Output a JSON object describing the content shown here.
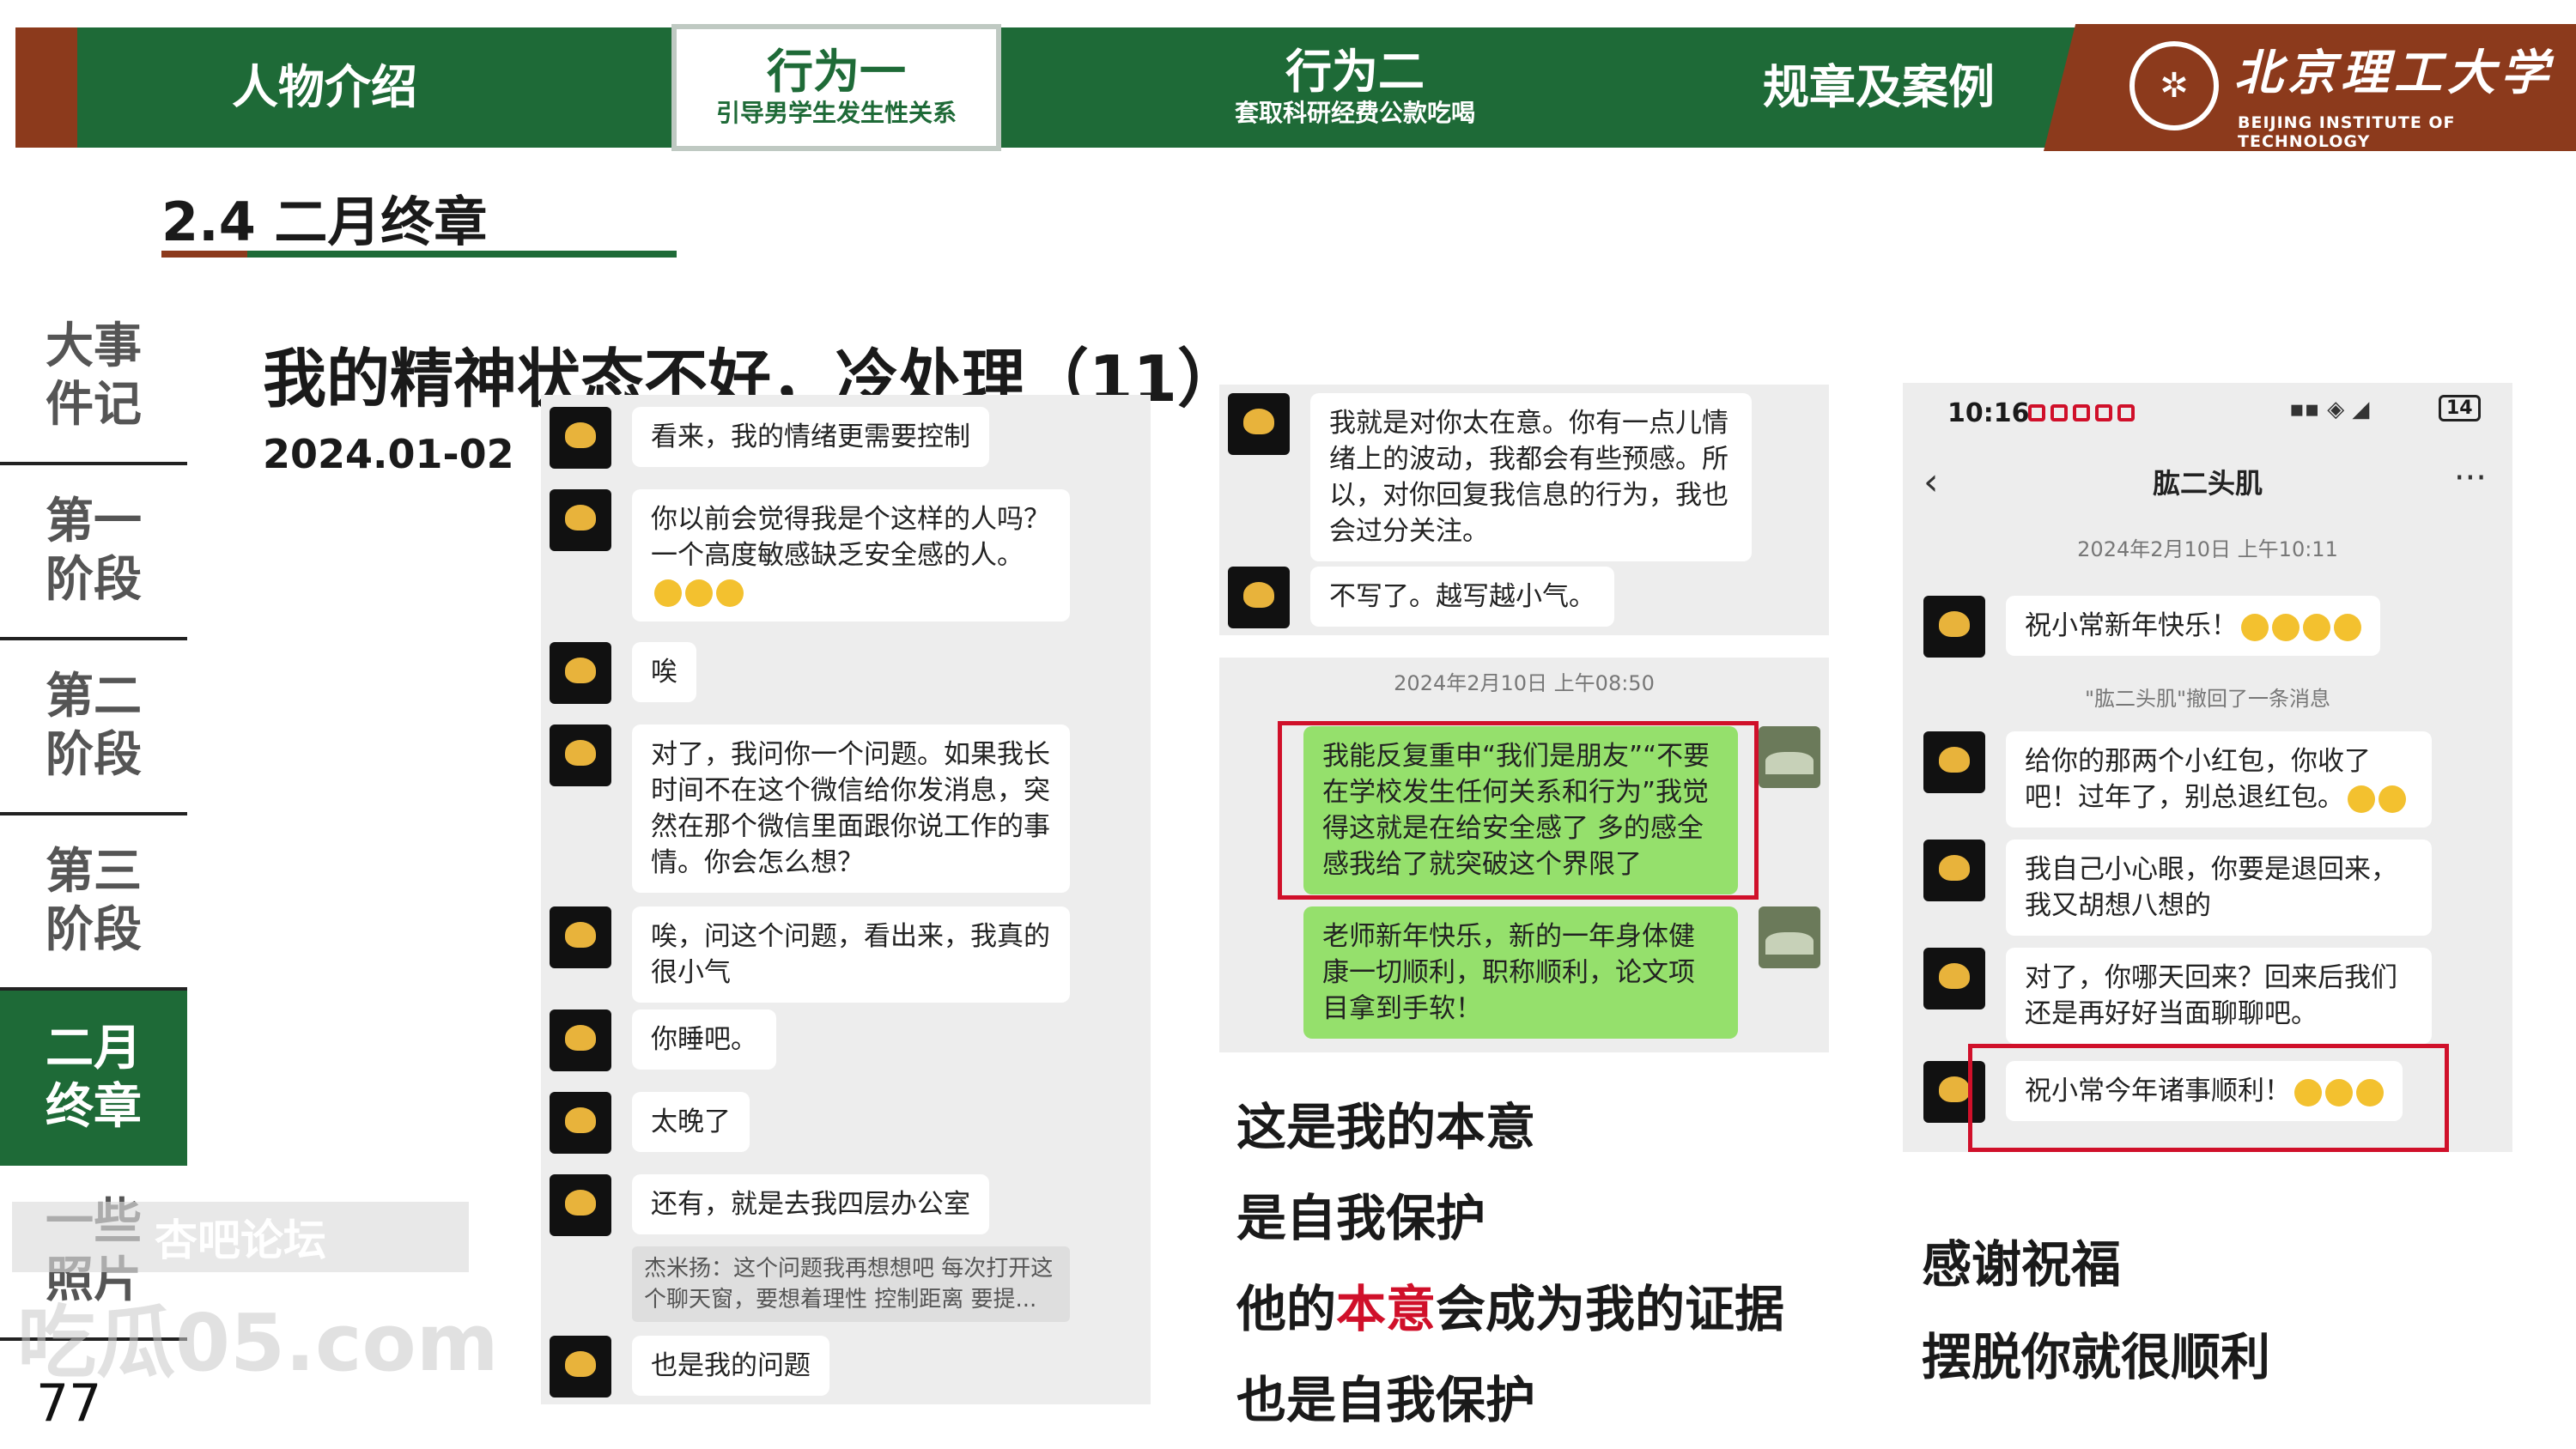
{
  "nav": {
    "tabs": [
      {
        "title": "人物介绍",
        "subtitle": ""
      },
      {
        "title": "行为一",
        "subtitle": "引导男学生发生性关系"
      },
      {
        "title": "行为二",
        "subtitle": "套取科研经费公款吃喝"
      },
      {
        "title": "规章及案例",
        "subtitle": ""
      }
    ],
    "university_cn": "北京理工大学",
    "university_en": "BEIJING INSTITUTE OF TECHNOLOGY"
  },
  "section_title": "2.4 二月终章",
  "sidebar": {
    "items": [
      "大事\n件记",
      "第一\n阶段",
      "第二\n阶段",
      "第三\n阶段",
      "二月\n终章",
      "一些\n照片"
    ]
  },
  "page_number": "77",
  "watermark": {
    "line1": "杏吧论坛",
    "line2": "吃瓜05.com"
  },
  "heading": "我的精神状态不好，冷处理（11）",
  "date": "2024.01-02",
  "chat1": {
    "messages": [
      "看来，我的情绪更需要控制",
      "你以前会觉得我是个这样的人吗？一个高度敏感缺乏安全感的人。",
      "唉",
      "对了，我问你一个问题。如果我长时间不在这个微信给你发消息，突然在那个微信里面跟你说工作的事情。你会怎么想？",
      "唉，问这个问题，看出来，我真的很小气",
      "你睡吧。",
      "太晚了",
      "还有，就是去我四层办公室",
      "也是我的问题"
    ],
    "quote": "杰米扬：这个问题我再想想吧 每次打开这个聊天窗，要想着理性 控制距离 要提..."
  },
  "chat2": {
    "top_messages": [
      "我就是对你太在意。你有一点儿情绪上的波动，我都会有些预感。所以，对你回复我信息的行为，我也会过分关注。",
      "不写了。越写越小气。"
    ],
    "timestamp": "2024年2月10日 上午08:50",
    "green_messages": [
      "我能反复重申“我们是朋友”“不要在学校发生任何关系和行为”我觉得这就是在给安全感了 多的感全感我给了就突破这个界限了",
      "老师新年快乐，新的一年身体健康一切顺利，职称顺利，论文项目拿到手软！"
    ]
  },
  "chat3": {
    "time": "10:16",
    "status_right": "14",
    "contact": "肱二头肌",
    "more": "···",
    "timestamp": "2024年2月10日 上午10:11",
    "messages": [
      "祝小常新年快乐！",
      "给你的那两个小红包，你收了吧！过年了，别总退红包。",
      "我自己小心眼，你要是退回来，我又胡想八想的",
      "对了，你哪天回来？回来后我们还是再好好当面聊聊吧。",
      "祝小常今年诸事顺利！"
    ],
    "recall_notice": "\"肱二头肌\"撤回了一条消息"
  },
  "captions_mid": {
    "line1": "这是我的本意",
    "line2": "是自我保护",
    "line3_a": "他的",
    "line3_red": "本意",
    "line3_b": "会成为我的证据",
    "line4": "也是自我保护"
  },
  "captions_right": {
    "line1": "感谢祝福",
    "line2": "摆脱你就很顺利"
  },
  "colors": {
    "brand_green": "#1e6a37",
    "brand_brown": "#8c3a1c",
    "alert_red": "#d0102a"
  }
}
